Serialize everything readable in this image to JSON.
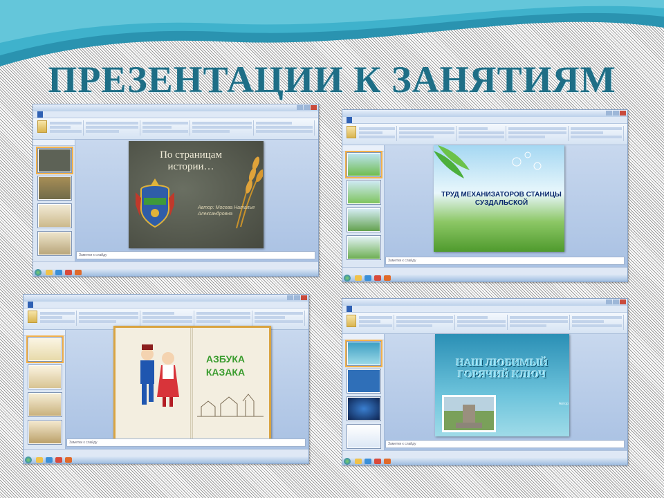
{
  "page": {
    "title": "ПРЕЗЕНТАЦИИ К ЗАНЯТИЯМ",
    "colors": {
      "title": "#1e6e86",
      "wave": "#2a93b0",
      "accent": "#f2b04a"
    }
  },
  "screenshots": [
    {
      "app": "PowerPoint",
      "window_title": "",
      "notes_placeholder": "Заметки к слайду",
      "slide": {
        "title": "По страницам истории…",
        "author": "Автор: Мосева Наталья Александровна"
      }
    },
    {
      "app": "PowerPoint",
      "window_title": "",
      "notes_placeholder": "Заметки к слайду",
      "slide": {
        "title": "ТРУД МЕХАНИЗАТОРОВ СТАНИЦЫ СУЗДАЛЬСКОЙ"
      }
    },
    {
      "app": "PowerPoint",
      "window_title": "",
      "notes_placeholder": "Заметки к слайду",
      "slide": {
        "title": "АЗБУКА КАЗАКА"
      }
    },
    {
      "app": "PowerPoint",
      "window_title": "",
      "notes_placeholder": "Заметки к слайду",
      "slide": {
        "title": "НАШ ЛЮБИМЫЙ ГОРЯЧИЙ КЛЮЧ",
        "author": "Автор:"
      }
    }
  ]
}
